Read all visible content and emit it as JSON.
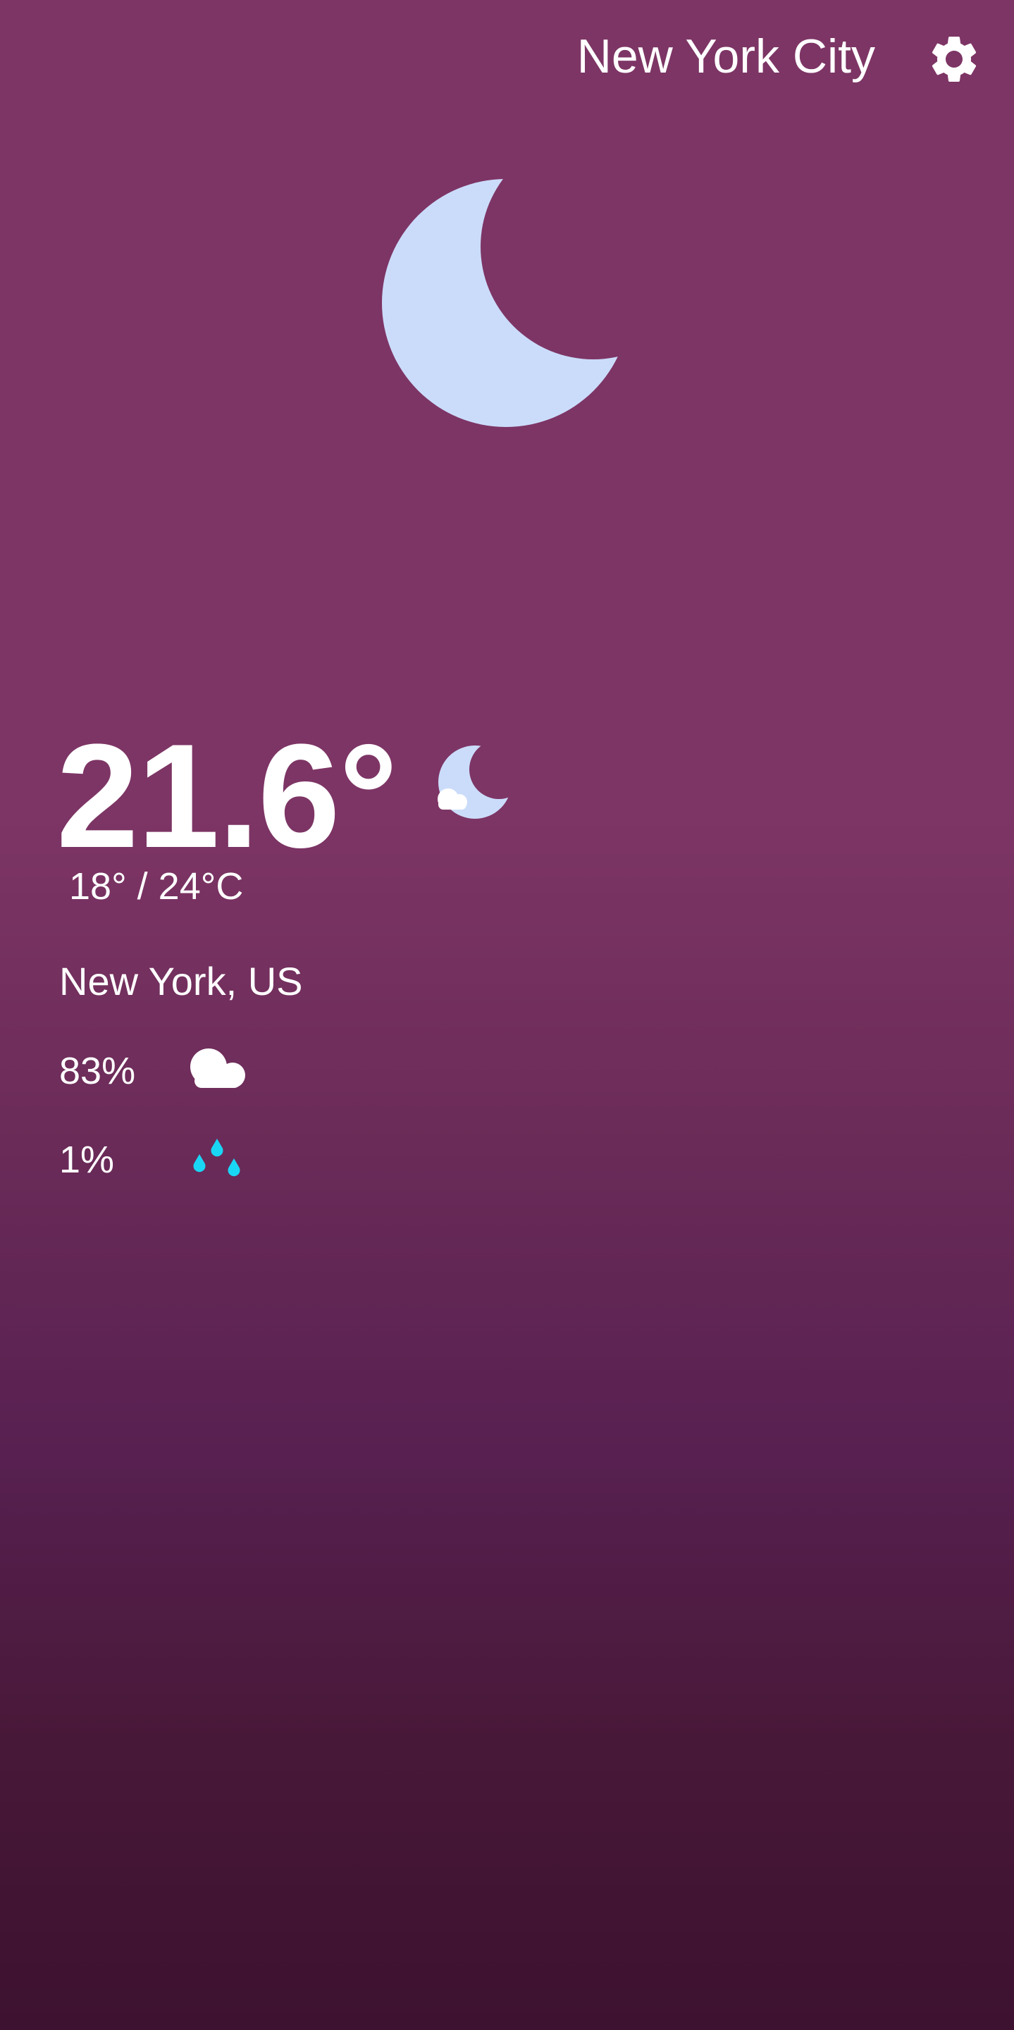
{
  "header": {
    "city": "New York City",
    "settings_icon": "gear-icon"
  },
  "current": {
    "condition_icon": "moon-icon",
    "temperature": "21.6°",
    "small_condition_icon": "moon-cloud-icon",
    "min_max": "18° / 24°C",
    "location": "New York, US"
  },
  "stats": {
    "cloudiness": {
      "value": "83%",
      "icon": "cloud-icon"
    },
    "precipitation": {
      "value": "1%",
      "icon": "raindrops-icon"
    }
  },
  "colors": {
    "background_top": "#7d3565",
    "background_bottom": "#3d1130",
    "moon": "#cbdcfa",
    "raindrop": "#1ad6f5",
    "text": "#ffffff"
  }
}
